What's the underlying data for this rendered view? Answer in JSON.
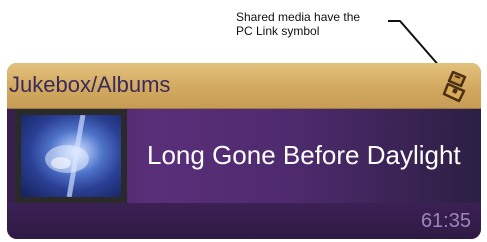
{
  "annotation": {
    "line1": "Shared media have the",
    "line2": "PC Link symbol"
  },
  "panel": {
    "title": "Jukebox/Albums",
    "status_icon": "pc-link-icon",
    "track_title": "Long Gone Before Daylight",
    "duration": "61:35"
  },
  "colors": {
    "header_gold": "#d2a95f",
    "title_text": "#3a2a5c",
    "body_purple": "#5a2f7a",
    "duration_text": "#9a86b8"
  }
}
